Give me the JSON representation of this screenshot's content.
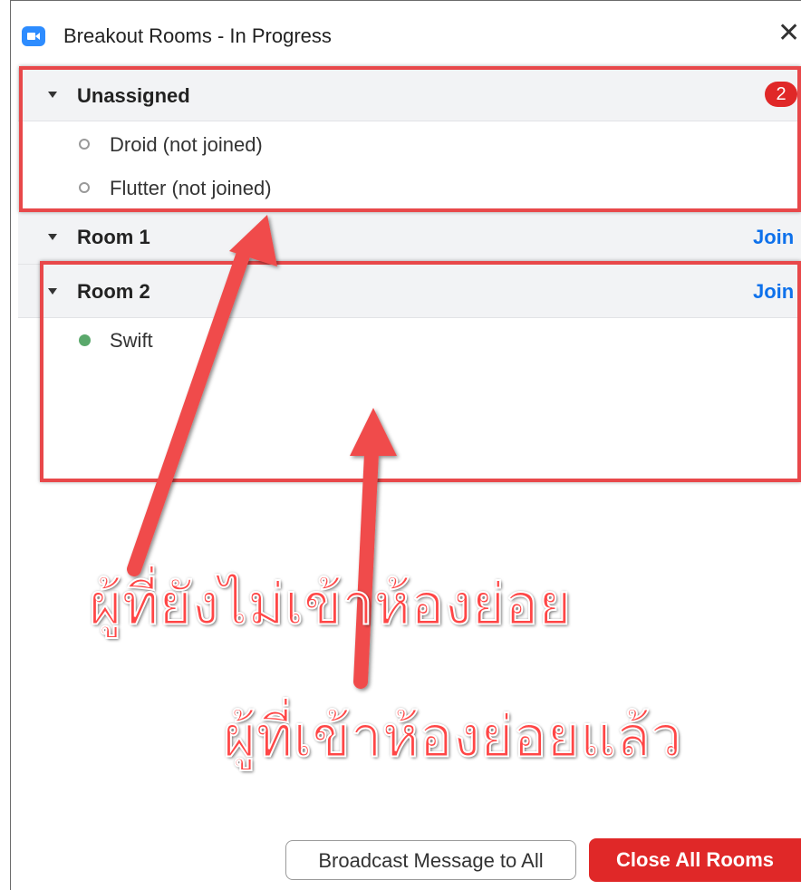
{
  "window": {
    "title": "Breakout Rooms - In Progress",
    "close_glyph": "✕",
    "app_icon": "zoom-camera-icon",
    "accent_color": "#2d8cff"
  },
  "sections": {
    "unassigned": {
      "label": "Unassigned",
      "badge": "2",
      "participants": [
        {
          "name": "Droid (not joined)",
          "status": "not-joined"
        },
        {
          "name": "Flutter (not joined)",
          "status": "not-joined"
        }
      ]
    },
    "room1": {
      "label": "Room 1",
      "join_label": "Join"
    },
    "room2": {
      "label": "Room 2",
      "join_label": "Join",
      "participants": [
        {
          "name": "Swift",
          "status": "joined"
        }
      ]
    }
  },
  "annotations": {
    "not_joined_text": "ผู้ที่ยังไม่เข้าห้องย่อย",
    "joined_text": "ผู้ที่เข้าห้องย่อยแล้ว",
    "highlight_color": "#e8484a"
  },
  "footer": {
    "broadcast_label": "Broadcast Message to All",
    "close_all_label": "Close All Rooms",
    "close_all_color": "#e02828"
  }
}
